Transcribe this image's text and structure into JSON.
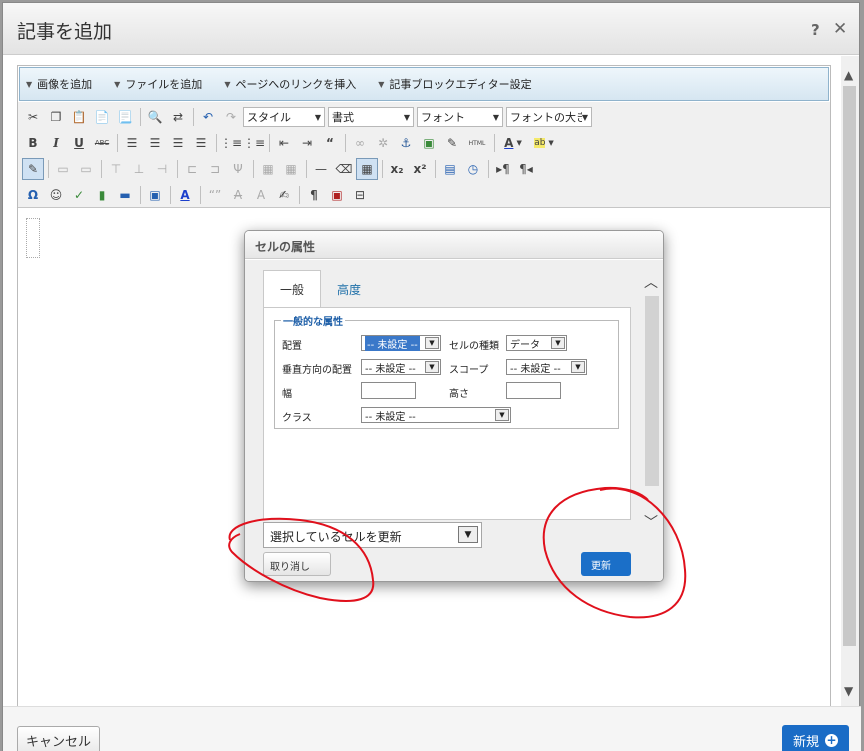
{
  "window": {
    "title": "記事を追加"
  },
  "plugins": [
    "画像を追加",
    "ファイルを追加",
    "ページへのリンクを挿入",
    "記事ブロックエディター設定"
  ],
  "toolbar": {
    "style_select": "スタイル",
    "format_select": "書式",
    "font_select": "フォント",
    "fontsize_select": "フォントの大きさ",
    "abc_label": "ABC",
    "html_label": "HTML"
  },
  "dialog": {
    "title": "セルの属性",
    "tabs": [
      "一般",
      "高度"
    ],
    "legend": "一般的な属性",
    "fields": {
      "align_label": "配置",
      "align_value": "-- 未設定 --",
      "celltype_label": "セルの種類",
      "celltype_value": "データ",
      "valign_label": "垂直方向の配置",
      "valign_value": "-- 未設定 --",
      "scope_label": "スコープ",
      "scope_value": "-- 未設定 --",
      "width_label": "幅",
      "width_value": "",
      "height_label": "高さ",
      "height_value": "",
      "class_label": "クラス",
      "class_value": "-- 未設定 --"
    },
    "update_select": "選択しているセルを更新",
    "cancel_label": "取り消し",
    "ok_label": "更新"
  },
  "footer": {
    "cancel_label": "キャンセル",
    "new_label": "新規"
  },
  "colors": {
    "accent": "#1a6cc6",
    "annotation": "#e0101c"
  }
}
